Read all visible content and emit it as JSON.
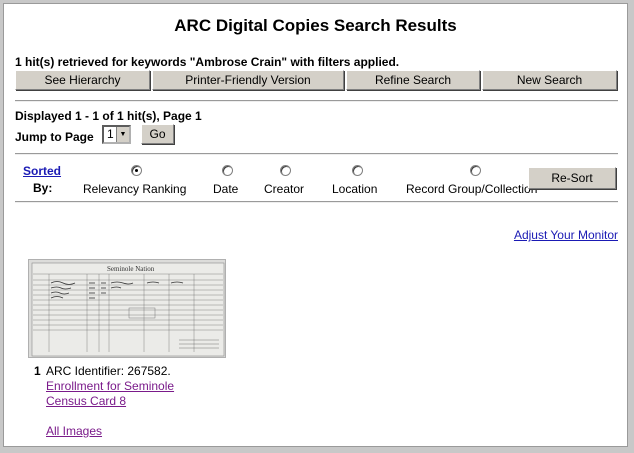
{
  "page": {
    "title": "ARC Digital Copies Search Results",
    "hits_summary": "1  hit(s) retrieved for keywords \"Ambrose Crain\" with filters applied."
  },
  "buttons": {
    "see_hierarchy": "See Hierarchy",
    "printer_friendly": "Printer-Friendly Version",
    "refine_search": "Refine Search",
    "new_search": "New Search"
  },
  "paging": {
    "displayed": "Displayed 1 -  1 of 1 hit(s),  Page 1",
    "jump_label": "Jump to Page",
    "page_value": "1",
    "go_label": "Go"
  },
  "sort": {
    "sorted_link": "Sorted",
    "by_label": "By:",
    "options": [
      {
        "label": "Relevancy Ranking",
        "checked": true
      },
      {
        "label": "Date",
        "checked": false
      },
      {
        "label": "Creator",
        "checked": false
      },
      {
        "label": "Location",
        "checked": false
      },
      {
        "label": "Record Group/Collection",
        "checked": false
      }
    ],
    "resort_label": "Re-Sort"
  },
  "adjust_monitor": "Adjust Your Monitor",
  "result": {
    "number": "1",
    "arc_identifier": "ARC Identifier: 267582.",
    "title_line1": "Enrollment for Seminole",
    "title_line2": "Census Card 8",
    "all_images": "All Images",
    "thumbnail_caption": "Seminole Nation"
  }
}
